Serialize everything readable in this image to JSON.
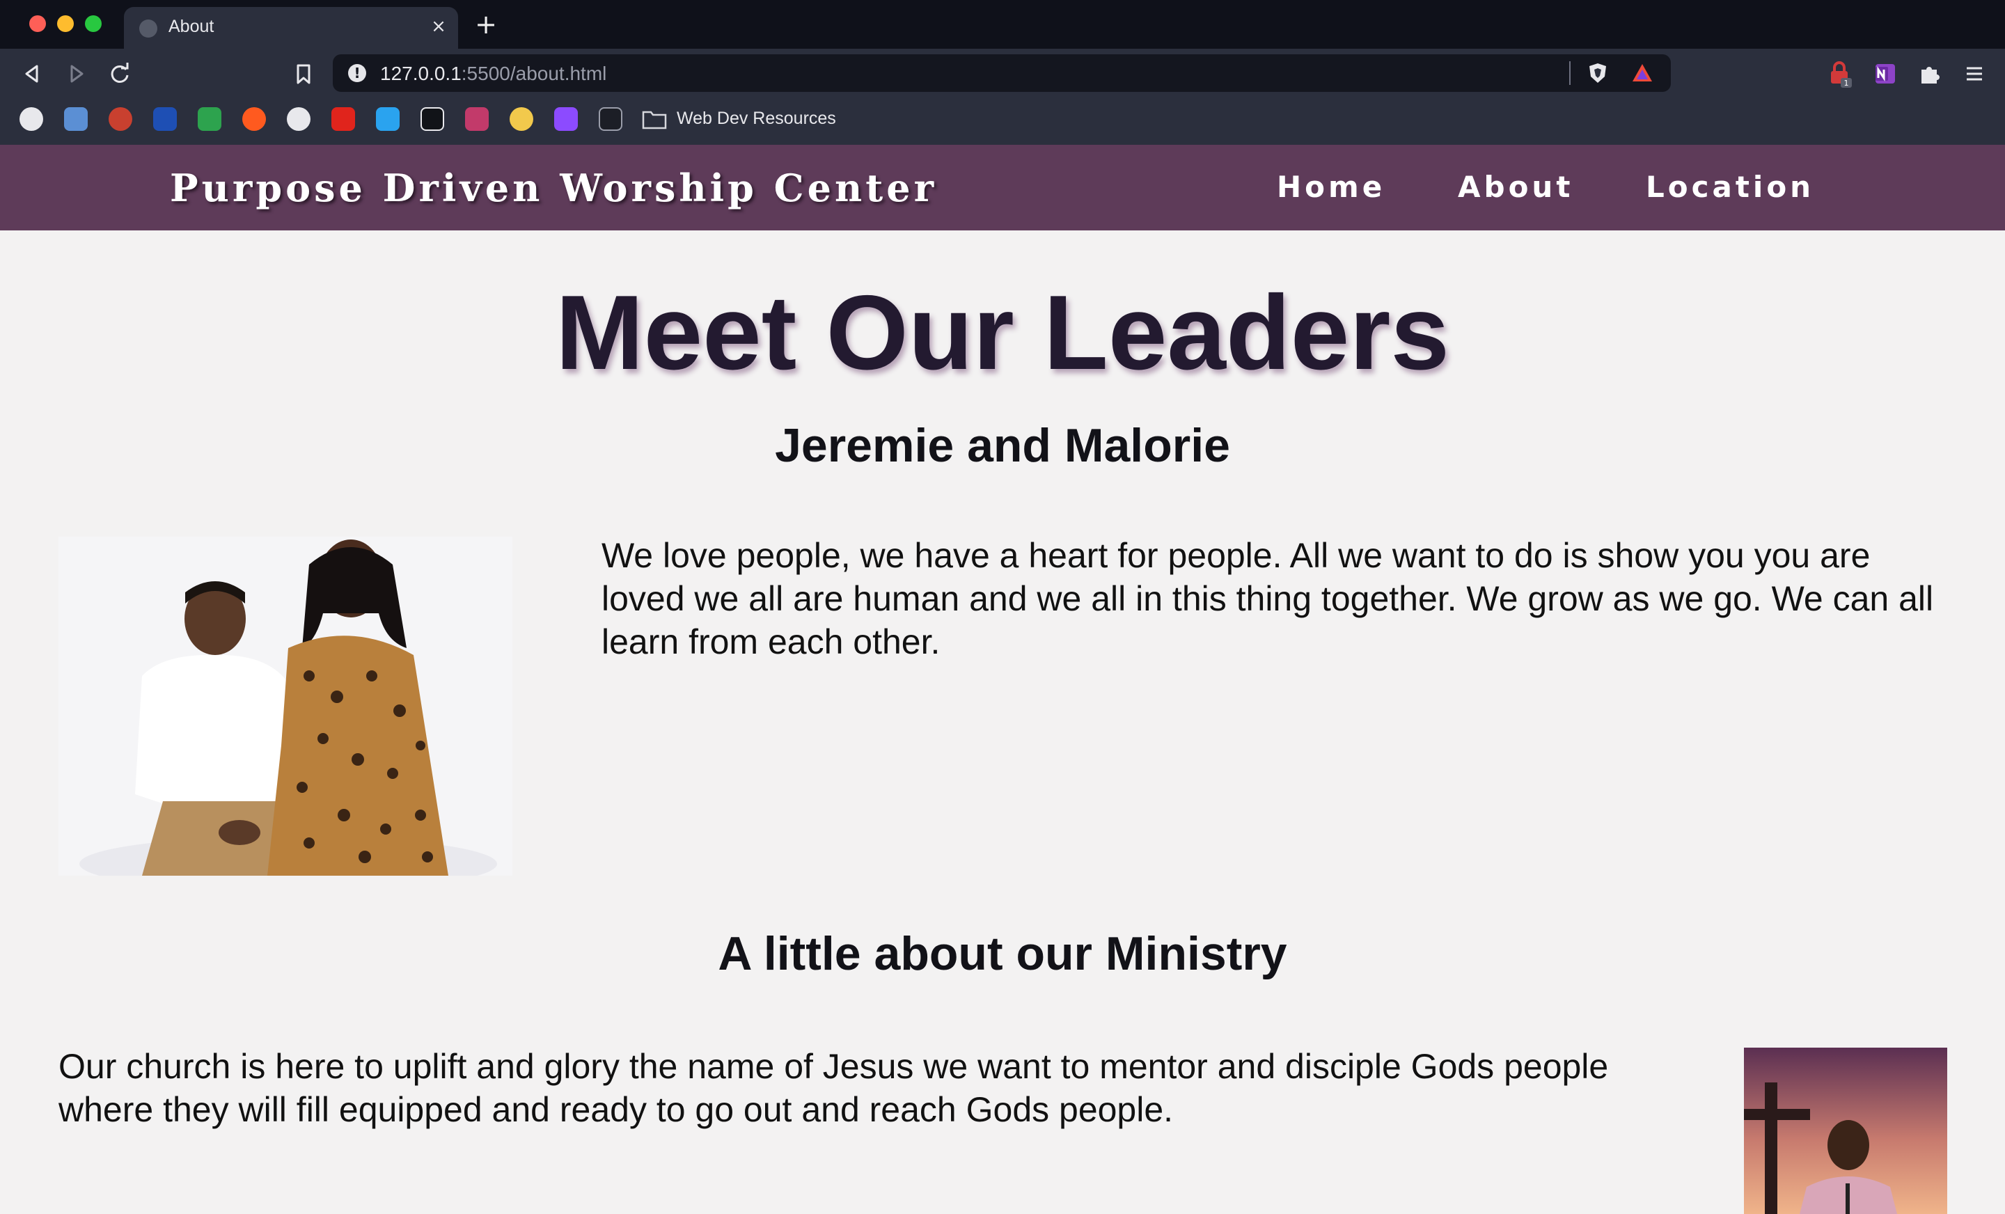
{
  "browser": {
    "tab": {
      "title": "About",
      "close_glyph": "×"
    },
    "new_tab_glyph": "+",
    "url": {
      "host": "127.0.0.1",
      "path": ":5500/about.html",
      "info_glyph": "!"
    },
    "bookmarks_folder_label": "Web Dev Resources",
    "extension_badge": "1",
    "icons": [
      "back-icon",
      "forward-icon",
      "reload-icon",
      "bookmark-page-icon",
      "brave-shield-icon",
      "brave-rewards-icon",
      "extension-lock-icon",
      "onenote-icon",
      "puzzle-extensions-icon",
      "menu-icon"
    ]
  },
  "site": {
    "brand": "Purpose Driven Worship Center",
    "nav": {
      "home": "Home",
      "about": "About",
      "location": "Location"
    }
  },
  "content": {
    "page_title": "Meet Our Leaders",
    "leaders_name": "Jeremie and Malorie",
    "leaders_text": "We love people, we have a heart for people. All we want to do is show you you are loved we all are human and we all in this thing together. We grow as we go. We can all learn from each other.",
    "ministry_title": "A little about our Ministry",
    "ministry_text": "Our church is here to uplift and glory the name of Jesus we want to mentor and disciple Gods people where they will fill equipped and ready to go out and reach Gods people."
  },
  "colors": {
    "header_bg": "#5e3b59",
    "page_bg": "#f3f2f2",
    "title_color": "#231a30",
    "chrome_dark": "#0f111a",
    "chrome_toolbar": "#2b2f3d"
  }
}
